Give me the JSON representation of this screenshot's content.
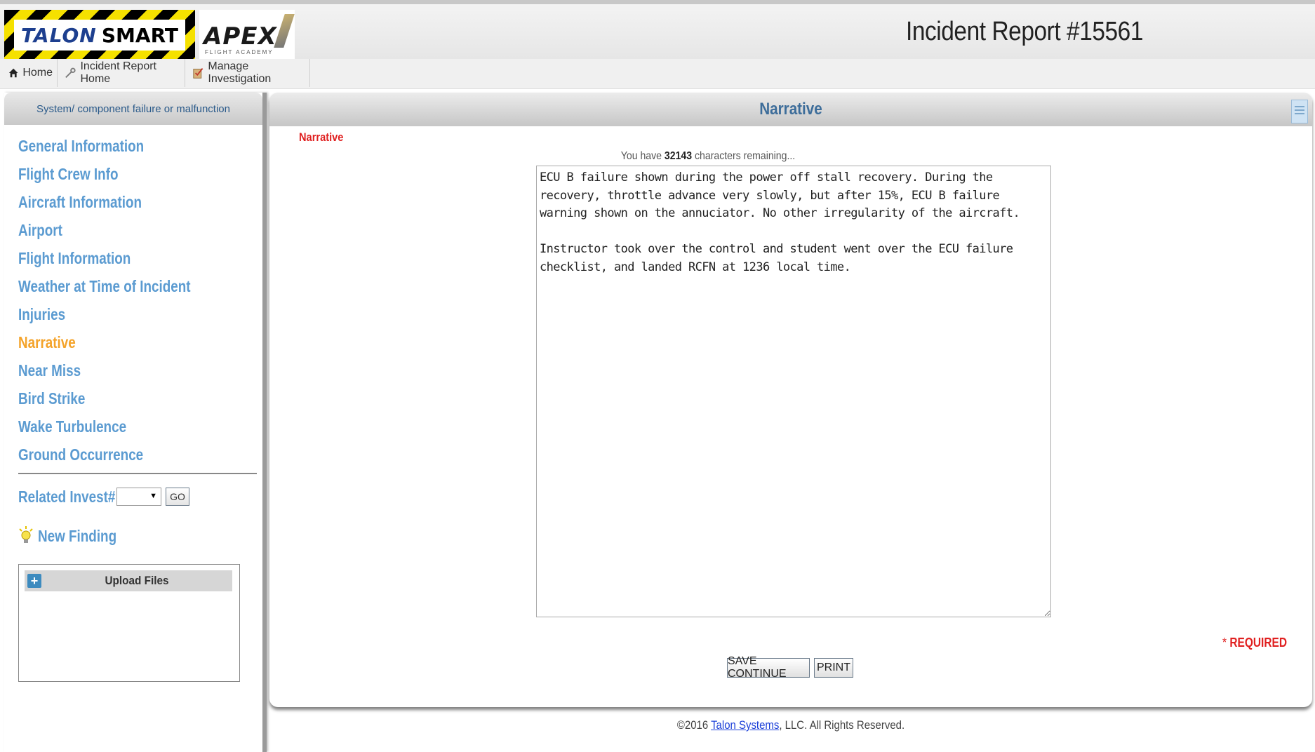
{
  "header": {
    "logo_talon_word": "TALON",
    "logo_smart_word": "SMART",
    "logo_apex_word": "APEX",
    "logo_apex_sub": "FLIGHT ACADEMY",
    "page_title": "Incident Report #15561"
  },
  "nav": {
    "home": "Home",
    "incident_report_home": "Incident Report Home",
    "manage_investigation": "Manage Investigation"
  },
  "sidebar": {
    "header": "System/ component failure or malfunction",
    "items": [
      {
        "label": "General Information",
        "active": false
      },
      {
        "label": "Flight Crew Info",
        "active": false
      },
      {
        "label": "Aircraft Information",
        "active": false
      },
      {
        "label": "Airport",
        "active": false
      },
      {
        "label": "Flight Information",
        "active": false
      },
      {
        "label": "Weather at Time of Incident",
        "active": false
      },
      {
        "label": "Injuries",
        "active": false
      },
      {
        "label": "Narrative",
        "active": true
      },
      {
        "label": "Near Miss",
        "active": false
      },
      {
        "label": "Bird Strike",
        "active": false
      },
      {
        "label": "Wake Turbulence",
        "active": false
      },
      {
        "label": "Ground Occurrence",
        "active": false
      }
    ],
    "related_label": "Related Invest#",
    "related_value": "",
    "go_label": "GO",
    "new_finding_label": "New Finding",
    "upload_label": "Upload Files"
  },
  "main": {
    "title": "Narrative",
    "section_label": "Narrative",
    "chars_prefix": "You have ",
    "chars_count": "32143",
    "chars_suffix": " characters remaining...",
    "narrative_text": "ECU B failure shown during the power off stall recovery. During the recovery, throttle advance very slowly, but after 15%, ECU B failure warning shown on the annuciator. No other irregularity of the aircraft.\n\nInstructor took over the control and student went over the ECU failure checklist, and landed RCFN at 1236 local time.",
    "required_star": "* ",
    "required_label": "REQUIRED",
    "save_label": "SAVE CONTINUE",
    "print_label": "PRINT"
  },
  "footer": {
    "copyright_prefix": "©2016 ",
    "company_link": "Talon Systems",
    "copyright_suffix": ", LLC. All Rights Reserved."
  },
  "colors": {
    "menu_link": "#5b9bd1",
    "menu_active": "#f4a32a",
    "required": "#e02020",
    "panel_title": "#3d6d9a"
  },
  "icons": {
    "home": "home-icon",
    "wrench": "wrench-icon",
    "clipboard": "clipboard-icon",
    "bulb": "lightbulb-icon",
    "plus": "plus-icon",
    "doc": "document-icon"
  }
}
